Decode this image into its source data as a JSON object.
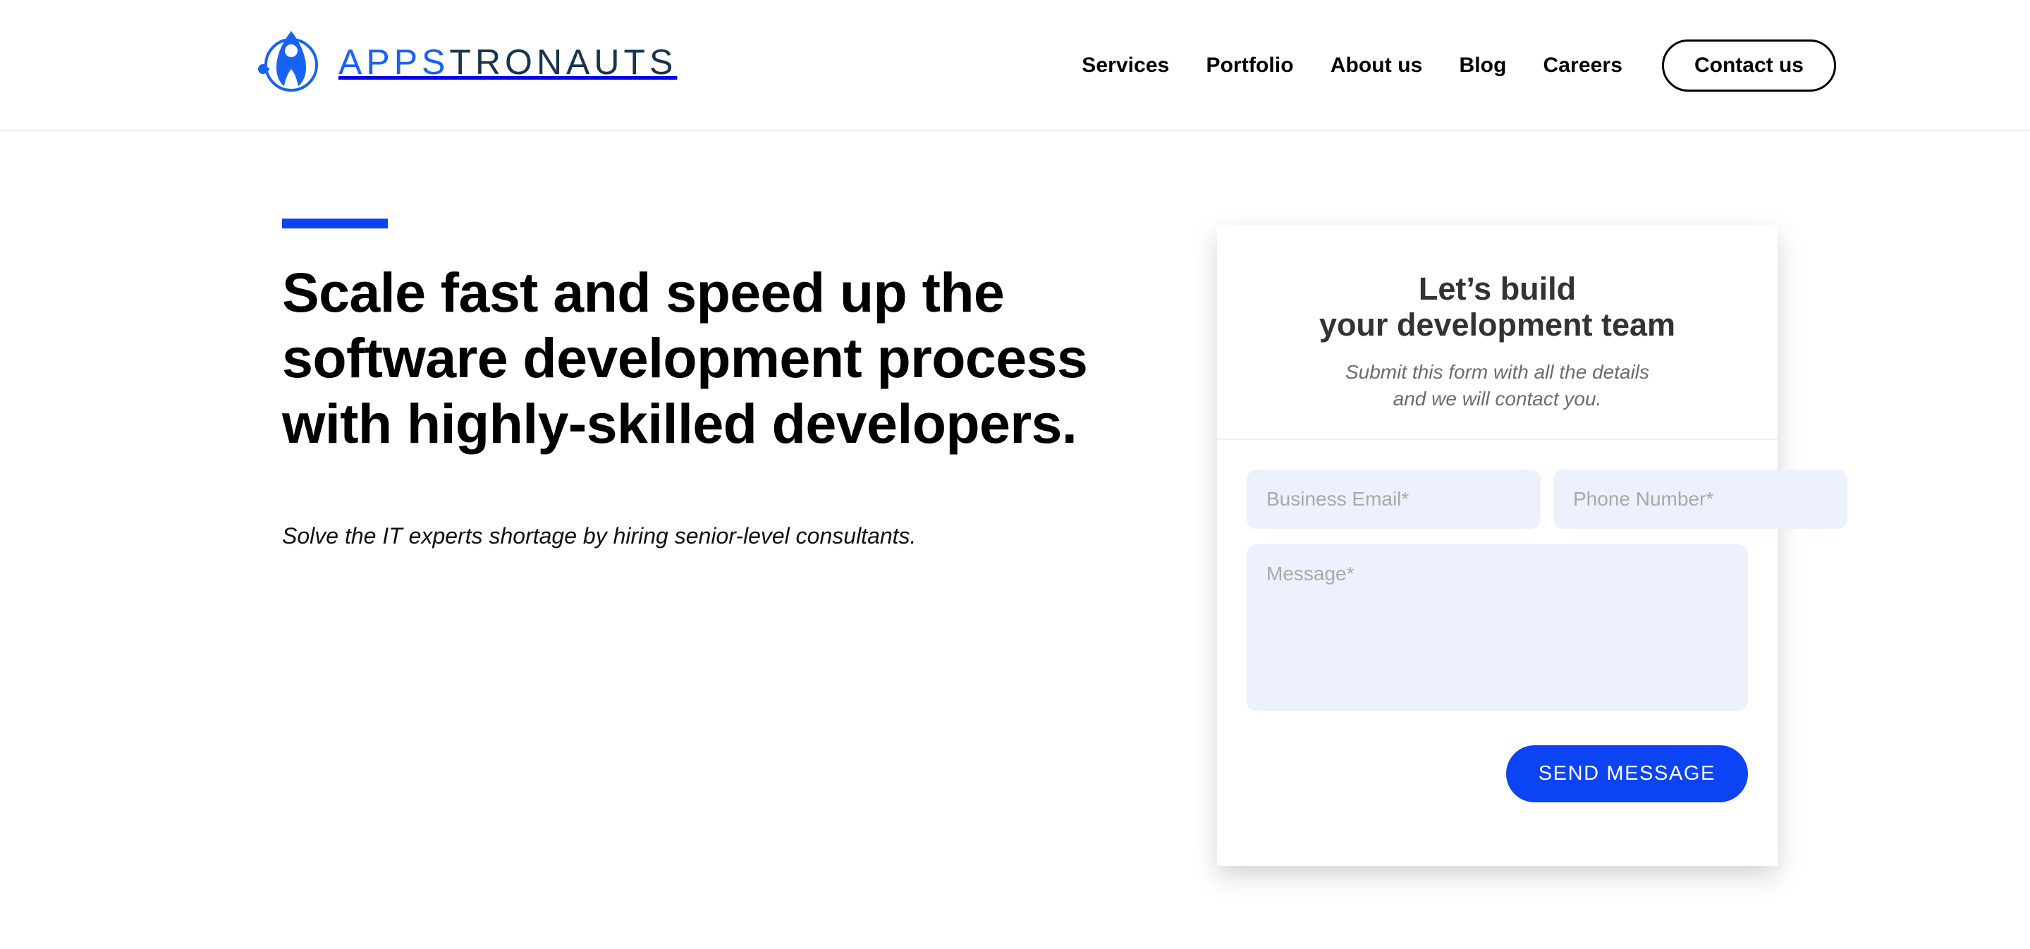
{
  "brand": {
    "logo_icon": "rocket-in-circle-icon",
    "name_primary": "APPS",
    "name_secondary": "TRONAUTS",
    "primary_color": "#1763f5",
    "secondary_color": "#17354f"
  },
  "nav": {
    "items": [
      {
        "label": "Services"
      },
      {
        "label": "Portfolio"
      },
      {
        "label": "About us"
      },
      {
        "label": "Blog"
      },
      {
        "label": "Careers"
      }
    ],
    "cta_label": "Contact us"
  },
  "hero": {
    "accent_color": "#0b43f5",
    "title": "Scale fast and speed up the software development process with highly-skilled developers.",
    "subtitle": "Solve the IT experts shortage by hiring senior-level consultants."
  },
  "form": {
    "title": "Let’s build\nyour development team",
    "subtitle": "Submit this form with all the details\nand we will contact you.",
    "email_value": "",
    "email_placeholder": "Business Email*",
    "phone_value": "",
    "phone_placeholder": "Phone Number*",
    "message_value": "",
    "message_placeholder": "Message*",
    "submit_label": "SEND MESSAGE",
    "submit_color": "#0b43f5",
    "field_bg": "#edf1fd"
  }
}
